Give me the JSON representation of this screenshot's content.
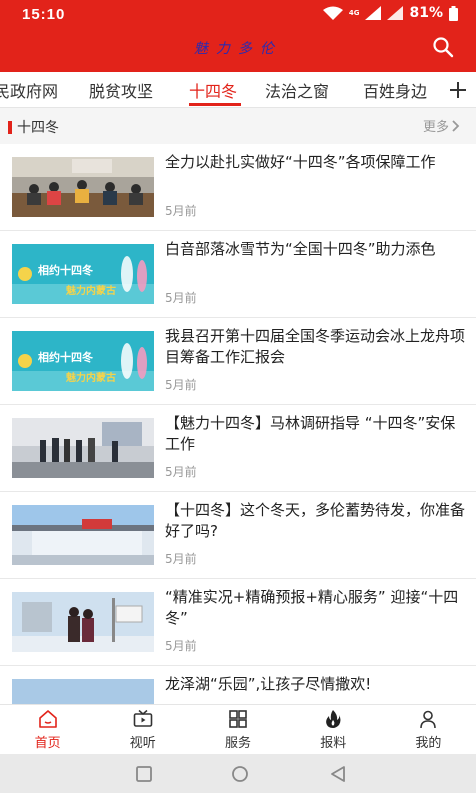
{
  "status_bar": {
    "time": "15:10",
    "network": "4G",
    "battery": "81%"
  },
  "header": {
    "title": "魅力多伦",
    "search_icon": "search-icon",
    "accent_color": "#e2231a"
  },
  "tabs": [
    {
      "label": "民政府网"
    },
    {
      "label": "脱贫攻坚"
    },
    {
      "label": "十四冬",
      "active": true
    },
    {
      "label": "法治之窗"
    },
    {
      "label": "百姓身边"
    }
  ],
  "tabs_more_icon": "plus-icon",
  "section": {
    "title": "十四冬",
    "more_label": "更多"
  },
  "news": [
    {
      "title": "全力以赴扎实做好“十四冬”各项保障工作",
      "time": "5月前",
      "thumb": "meeting-photo"
    },
    {
      "title": "白音部落冰雪节为“全国十四冬”助力添色",
      "time": "5月前",
      "thumb": "banner-14th-winter-games"
    },
    {
      "title": "我县召开第十四届全国冬季运动会冰上龙舟项目筹备工作汇报会",
      "time": "5月前",
      "thumb": "banner-14th-winter-games"
    },
    {
      "title": "【魅力十四冬】马林调研指导 “十四冬”安保工作",
      "time": "5月前",
      "thumb": "inspection-photo"
    },
    {
      "title": "【十四冬】这个冬天，多伦蓄势待发，你准备好了吗?",
      "time": "5月前",
      "thumb": "ice-rink-photo"
    },
    {
      "title": "“精准实况+精确预报+精心服务” 迎接“十四冬”",
      "time": "5月前",
      "thumb": "weather-station-photo"
    },
    {
      "title": "龙泽湖“乐园”,让孩子尽情撒欢!",
      "time": "",
      "thumb": "lake-photo"
    }
  ],
  "banner_text": {
    "left": "相约十四冬",
    "right": "魅力内蒙古"
  },
  "bottom_nav": [
    {
      "label": "首页",
      "icon": "home-icon",
      "active": true
    },
    {
      "label": "视听",
      "icon": "tv-icon"
    },
    {
      "label": "服务",
      "icon": "grid-icon"
    },
    {
      "label": "报料",
      "icon": "fire-icon"
    },
    {
      "label": "我的",
      "icon": "user-icon"
    }
  ]
}
